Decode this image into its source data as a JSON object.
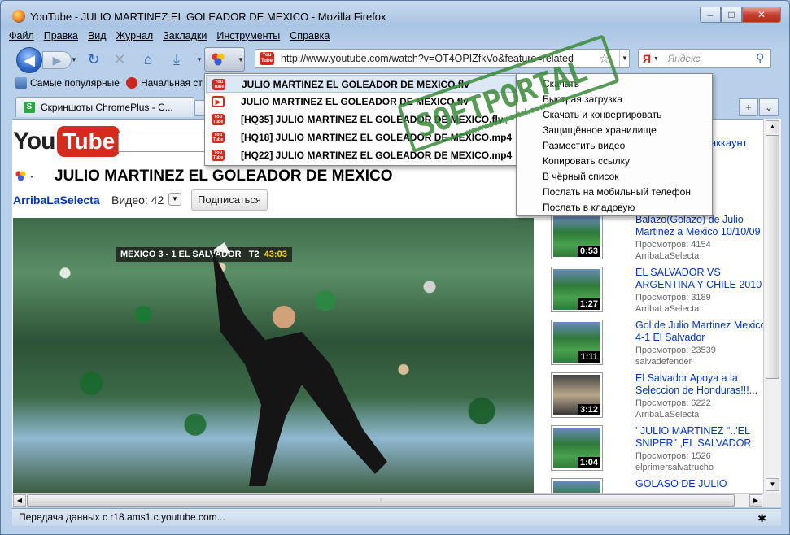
{
  "window": {
    "title": "YouTube - JULIO MARTINEZ EL GOLEADOR DE MEXICO - Mozilla Firefox"
  },
  "menu": [
    "Файл",
    "Правка",
    "Вид",
    "Журнал",
    "Закладки",
    "Инструменты",
    "Справка"
  ],
  "nav": {
    "url": "http://www.youtube.com/watch?v=OT4OPIZfkVo&feature=related",
    "search_placeholder": "Яндекс",
    "search_engine_glyph": "Я"
  },
  "bookmarks": [
    {
      "label": "Самые популярные"
    },
    {
      "label": "Начальная ст"
    }
  ],
  "tabs": [
    {
      "label": "Скриншоты ChromePlus - C..."
    }
  ],
  "page": {
    "logo_you": "You",
    "logo_tube": "Tube",
    "account": "аккаунт",
    "video_title": "JULIO MARTINEZ EL GOLEADOR DE MEXICO",
    "channel": "ArribaLaSelecta",
    "video_count": "Видео: 42",
    "subscribe": "Подписаться",
    "scoreboard": {
      "text": "MEXICO  3 - 1  EL SALVADOR",
      "period": "T2",
      "clock": "43:03"
    }
  },
  "related": [
    {
      "title": "Balazo(Golazo) de Julio\nMartinez a Mexico 10/10/09",
      "views": "Просмотров: 4154",
      "author": "ArribaLaSelecta",
      "duration": "0:53"
    },
    {
      "title": "EL SALVADOR VS\nARGENTINA Y CHILE 2010",
      "views": "Просмотров: 3189",
      "author": "ArribaLaSelecta",
      "duration": "1:27"
    },
    {
      "title": "Gol de Julio Martinez Mexico\n4-1 El Salvador",
      "views": "Просмотров: 23539",
      "author": "salvadefender",
      "duration": "1:11"
    },
    {
      "title": "El Salvador Apoya a la\nSeleccion de Honduras!!!...",
      "views": "Просмотров: 6222",
      "author": "ArribaLaSelecta",
      "duration": "3:12"
    },
    {
      "title": "' JULIO MARTINEZ \"..'EL\nSNIPER\" ,EL SALVADOR",
      "views": "Просмотров: 1526",
      "author": "elprimersalvatrucho",
      "duration": "1:04"
    },
    {
      "title": "GOLASO DE JULIO",
      "views": "",
      "author": "",
      "duration": ""
    }
  ],
  "download_popup": [
    {
      "label": "JULIO MARTINEZ EL GOLEADOR DE MEXICO.flv",
      "icon": "youtube-icon",
      "highlighted": true
    },
    {
      "label": "JULIO MARTINEZ EL GOLEADOR DE MEXICO.flv",
      "icon": "flash-video-icon",
      "highlighted": false
    },
    {
      "label": "[HQ35] JULIO MARTINEZ EL GOLEADOR DE MEXICO.flv",
      "icon": "youtube-icon",
      "highlighted": false
    },
    {
      "label": "[HQ18] JULIO MARTINEZ EL GOLEADOR DE MEXICO.mp4",
      "icon": "youtube-icon",
      "highlighted": false
    },
    {
      "label": "[HQ22] JULIO MARTINEZ EL GOLEADOR DE MEXICO.mp4",
      "icon": "youtube-icon",
      "highlighted": false
    }
  ],
  "context_menu": [
    "Скачать",
    "Быстрая загрузка",
    "Скачать и конвертировать",
    "Защищённое хранилище",
    "Разместить видео",
    "Копировать ссылку",
    "В чёрный список",
    "Послать на мобильный телефон",
    "Послать в кладовую"
  ],
  "watermark": {
    "text": "SOFTPORTAL",
    "url": "www.softportal.com"
  },
  "status": "Передача данных с r18.ams1.c.youtube.com...",
  "colors": {
    "youtube_red": "#d62a1e",
    "link_blue": "#0033cc",
    "stamp_green": "#3a8a3a"
  }
}
